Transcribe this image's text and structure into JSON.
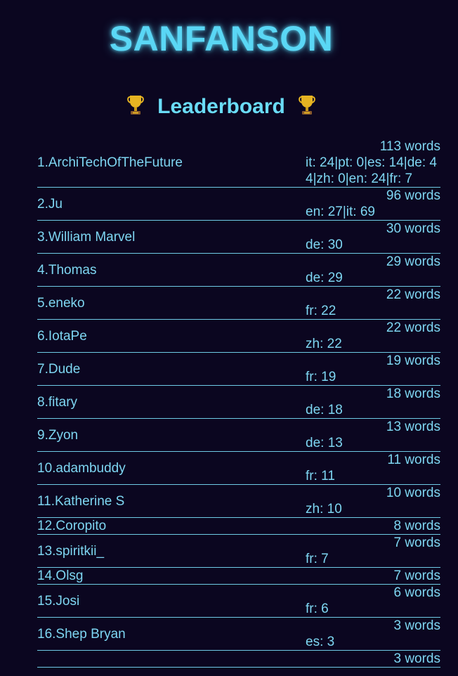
{
  "header": {
    "title": "SANFANSON"
  },
  "leaderboard": {
    "title": "Leaderboard",
    "trophy_icon": "trophy-icon",
    "rows": [
      {
        "rank_name": "1.ArchiTechOfTheFuture",
        "count": "113 words",
        "langs": "it: 24|pt: 0|es: 14|de: 44|zh: 0|en: 24|fr: 7"
      },
      {
        "rank_name": "2.Ju",
        "count": "96 words",
        "langs": "en: 27|it: 69"
      },
      {
        "rank_name": "3.William Marvel",
        "count": "30 words",
        "langs": "de: 30"
      },
      {
        "rank_name": "4.Thomas",
        "count": "29 words",
        "langs": "de: 29"
      },
      {
        "rank_name": "5.eneko",
        "count": "22 words",
        "langs": "fr: 22"
      },
      {
        "rank_name": "6.IotaPe",
        "count": "22 words",
        "langs": "zh: 22"
      },
      {
        "rank_name": "7.Dude",
        "count": "19 words",
        "langs": "fr: 19"
      },
      {
        "rank_name": "8.fitary",
        "count": "18 words",
        "langs": "de: 18"
      },
      {
        "rank_name": "9.Zyon",
        "count": "13 words",
        "langs": "de: 13"
      },
      {
        "rank_name": "10.adambuddy",
        "count": "11 words",
        "langs": "fr: 11"
      },
      {
        "rank_name": "11.Katherine S",
        "count": "10 words",
        "langs": "zh: 10"
      },
      {
        "rank_name": "12.Coropito",
        "count": "8 words",
        "langs": ""
      },
      {
        "rank_name": "13.spiritkii_",
        "count": "7 words",
        "langs": "fr: 7"
      },
      {
        "rank_name": "14.Olsg",
        "count": "7 words",
        "langs": ""
      },
      {
        "rank_name": "15.Josi",
        "count": "6 words",
        "langs": "fr: 6"
      },
      {
        "rank_name": "16.Shep Bryan",
        "count": "3 words",
        "langs": "es: 3"
      },
      {
        "rank_name": "",
        "count": "3 words",
        "langs": ""
      }
    ]
  },
  "colors": {
    "background": "#0b0620",
    "accent": "#5ad7f5",
    "text": "#7ed6f2",
    "divider": "#6fcbe6"
  }
}
